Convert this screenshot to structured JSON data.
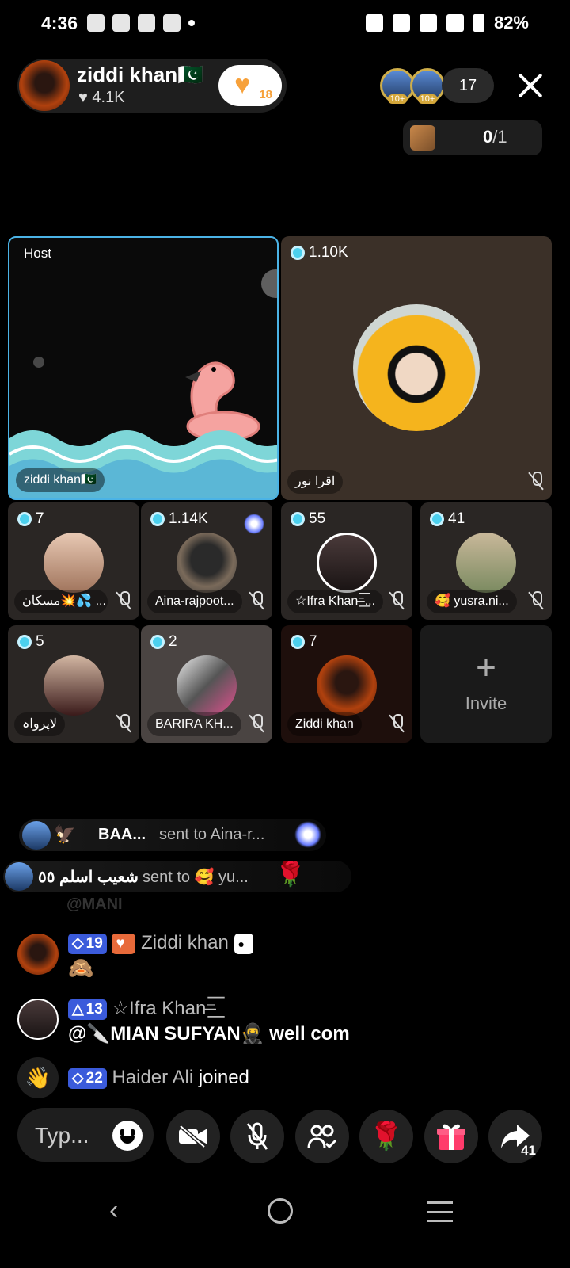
{
  "status_bar": {
    "time": "4:36",
    "battery": "82%"
  },
  "host": {
    "name": "ziddi khan🇵🇰",
    "likes": "♥ 4.1K",
    "fans_badge": "18"
  },
  "viewers": {
    "badges": [
      "10+",
      "10+"
    ],
    "count": "17"
  },
  "seats": {
    "filled": "0",
    "total": "/1"
  },
  "grid": {
    "host_tile": {
      "tag": "Host",
      "name": "ziddi khan🇵🇰"
    },
    "guest_tile": {
      "count": "1.10K",
      "name": "اقرا نور"
    },
    "small_tiles": [
      {
        "count": "7",
        "name": "مسکان💥💦 ..."
      },
      {
        "count": "1.14K",
        "name": "Aina-rajpoot..."
      },
      {
        "count": "55",
        "name": "☆Ifra Khan⁻̶͟͞..."
      },
      {
        "count": "41",
        "name": "🥰 yusra.ni..."
      },
      {
        "count": "5",
        "name": "لاپرواہ"
      },
      {
        "count": "2",
        "name": "BARIRA KH..."
      },
      {
        "count": "7",
        "name": "Ziddi khan"
      }
    ],
    "invite_label": "Invite"
  },
  "banners": [
    {
      "sender": "BAA...",
      "text": "sent to Aina-r..."
    },
    {
      "sender": "شعیب اسلم ٥٥",
      "text": "sent to 🥰 yu..."
    }
  ],
  "chat": {
    "faded_name": "@MANI",
    "messages": [
      {
        "level": "19",
        "name": "Ziddi khan",
        "text": "🙈"
      },
      {
        "level": "13",
        "name": "☆Ifra Khan⁻̶͟͞",
        "text": "@🔪MIAN SUFYAN🥷 well com"
      }
    ],
    "join": {
      "level": "22",
      "name": "Haider Ali",
      "text": "joined"
    }
  },
  "bottom_bar": {
    "placeholder": "Typ...",
    "share_count": "41"
  },
  "colors": {
    "host_border": "#4bb3e6",
    "level_badge": "#3b5bdb",
    "background": "#000000"
  }
}
